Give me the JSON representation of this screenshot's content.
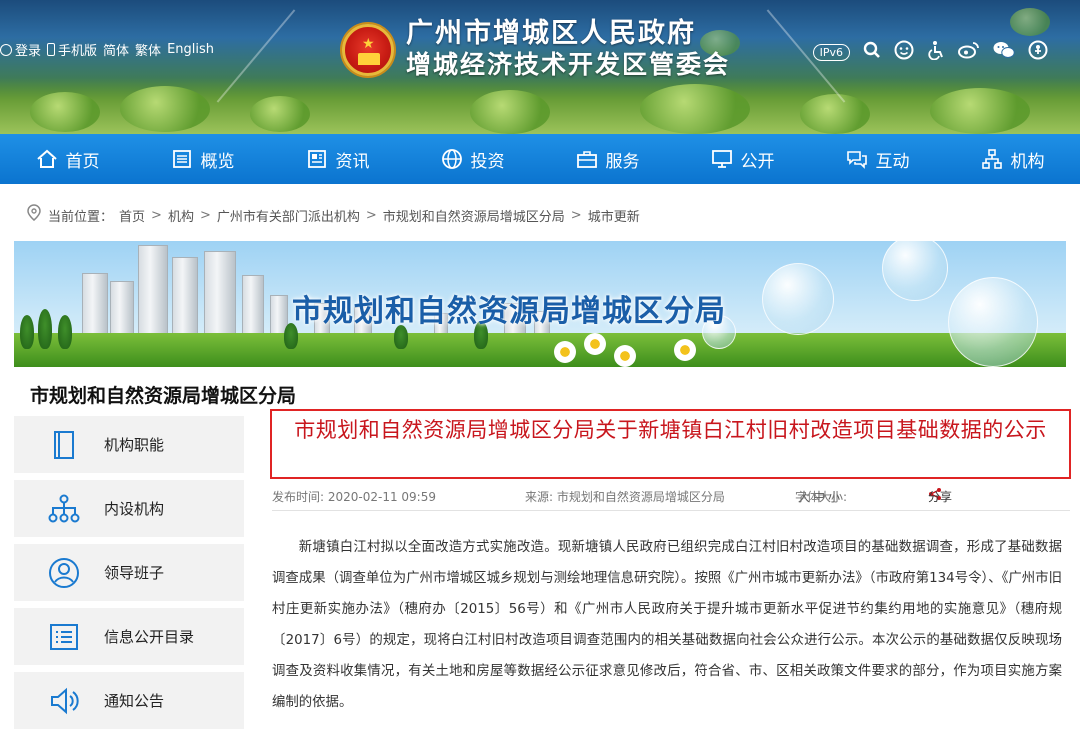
{
  "header": {
    "top_links": {
      "login": "登录",
      "mobile": "手机版",
      "simplified": "简体",
      "traditional": "繁体",
      "english": "English"
    },
    "title_line1": "广州市增城区人民政府",
    "title_line2": "增城经济技术开发区管委会",
    "tools": {
      "ipv6": "IPv6"
    },
    "icons": [
      "search-icon",
      "elderly-mode-icon",
      "accessibility-icon",
      "weibo-icon",
      "wechat-icon",
      "voice-reader-icon"
    ]
  },
  "nav": {
    "items": [
      {
        "label": "首页",
        "icon": "home-icon"
      },
      {
        "label": "概览",
        "icon": "overview-icon"
      },
      {
        "label": "资讯",
        "icon": "news-icon"
      },
      {
        "label": "投资",
        "icon": "globe-icon"
      },
      {
        "label": "服务",
        "icon": "briefcase-icon"
      },
      {
        "label": "公开",
        "icon": "monitor-icon"
      },
      {
        "label": "互动",
        "icon": "chat-icon"
      },
      {
        "label": "机构",
        "icon": "org-chart-icon"
      }
    ]
  },
  "breadcrumb": {
    "prefix": "当前位置：",
    "items": [
      "首页",
      "机构",
      "广州市有关部门派出机构",
      "市规划和自然资源局增城区分局",
      "城市更新"
    ],
    "separator": ">"
  },
  "banner": {
    "title": "市规划和自然资源局增城区分局"
  },
  "sidebar": {
    "title": "市规划和自然资源局增城区分局",
    "items": [
      {
        "label": "机构职能",
        "icon": "book-icon"
      },
      {
        "label": "内设机构",
        "icon": "org-chart-icon"
      },
      {
        "label": "领导班子",
        "icon": "person-icon"
      },
      {
        "label": "信息公开目录",
        "icon": "list-icon"
      },
      {
        "label": "通知公告",
        "icon": "speaker-icon"
      }
    ]
  },
  "article": {
    "title": "市规划和自然资源局增城区分局关于新塘镇白江村旧村改造项目基础数据的公示",
    "publish_time": "发布时间: 2020-02-11 09:59",
    "source": "来源: 市规划和自然资源局增城区分局",
    "font_size_label": "字体大小:",
    "font_sizes": [
      "大",
      "中",
      "小"
    ],
    "share": "分享",
    "body": "新塘镇白江村拟以全面改造方式实施改造。现新塘镇人民政府已组织完成白江村旧村改造项目的基础数据调查，形成了基础数据调查成果（调查单位为广州市增城区城乡规划与测绘地理信息研究院）。按照《广州市城市更新办法》（市政府第134号令）、《广州市旧村庄更新实施办法》（穗府办〔2015〕56号）和《广州市人民政府关于提升城市更新水平促进节约集约用地的实施意见》（穗府规〔2017〕6号）的规定，现将白江村旧村改造项目调查范围内的相关基础数据向社会公众进行公示。本次公示的基础数据仅反映现场调查及资料收集情况，有关土地和房屋等数据经公示征求意见修改后，符合省、市、区相关政策文件要求的部分，作为项目实施方案编制的依据。"
  },
  "colors": {
    "nav_blue": "#0b74cf",
    "headline_red": "#c8161d",
    "border_red": "#e02424",
    "banner_title": "#1a5ea8"
  }
}
